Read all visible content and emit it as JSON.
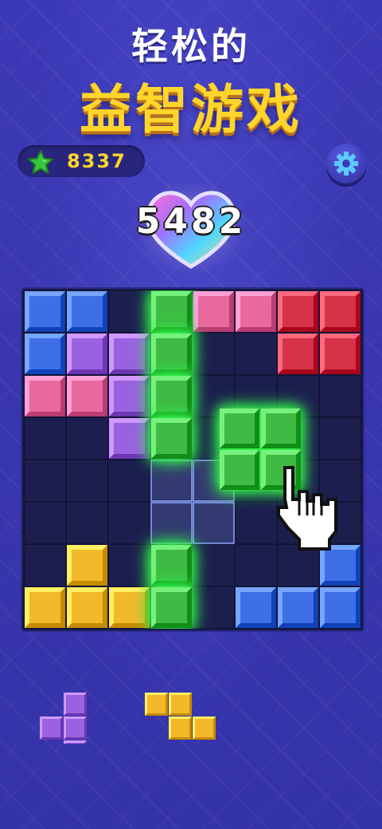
{
  "header": {
    "line1": "轻松的",
    "line2": "益智游戏"
  },
  "currency": {
    "icon": "star-icon",
    "value": "8337"
  },
  "settings": {
    "icon": "gear-icon"
  },
  "score": {
    "value": "5482",
    "icon": "heart-icon"
  },
  "board": {
    "cols": 8,
    "rows": 8,
    "colors": {
      "blue": "#3f6fe6",
      "purple": "#9a62e0",
      "pink": "#e8699f",
      "red": "#d63348",
      "green": "#3fbb45",
      "yellow": "#f2b92a",
      "empty": "#1c1f4e"
    },
    "cells": [
      [
        "blue",
        "blue",
        "",
        "green",
        "pink",
        "pink",
        "red",
        "red"
      ],
      [
        "blue",
        "purple",
        "purple",
        "green",
        "",
        "",
        "red",
        "red"
      ],
      [
        "pink",
        "pink",
        "purple",
        "green",
        "",
        "",
        "",
        ""
      ],
      [
        "",
        "",
        "purple",
        "green",
        "",
        "",
        "",
        ""
      ],
      [
        "",
        "",
        "",
        "",
        "",
        "",
        "",
        ""
      ],
      [
        "",
        "",
        "",
        "",
        "",
        "",
        "",
        ""
      ],
      [
        "",
        "yellow",
        "",
        "green",
        "",
        "",
        "",
        "blue"
      ],
      [
        "yellow",
        "yellow",
        "yellow",
        "green",
        "",
        "blue",
        "blue",
        "blue"
      ]
    ],
    "highlight_column": 3,
    "ghost": [
      [
        4,
        3
      ],
      [
        4,
        4
      ],
      [
        5,
        3
      ],
      [
        5,
        4
      ]
    ]
  },
  "dragging_piece": {
    "color": "green",
    "shape": "square-2x2"
  },
  "tray": [
    {
      "color": "purple",
      "shape": [
        [
          0,
          1
        ],
        [
          1,
          0
        ],
        [
          1,
          1
        ],
        [
          2,
          1
        ]
      ]
    },
    {
      "color": "yellow",
      "shape": [
        [
          0,
          0
        ],
        [
          0,
          1
        ],
        [
          1,
          1
        ],
        [
          1,
          2
        ]
      ]
    }
  ]
}
